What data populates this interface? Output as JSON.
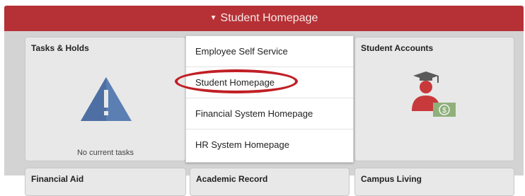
{
  "header": {
    "title": "Student Homepage",
    "caret": "▼"
  },
  "tiles": {
    "tasks": {
      "title": "Tasks & Holds",
      "subtitle": "No current tasks"
    },
    "accounts": {
      "title": "Student Accounts"
    },
    "financial_aid": {
      "title": "Financial Aid"
    },
    "academic_record": {
      "title": "Academic Record"
    },
    "campus_living": {
      "title": "Campus Living"
    }
  },
  "dropdown": {
    "items": [
      {
        "label": "Employee Self Service"
      },
      {
        "label": "Student Homepage"
      },
      {
        "label": "Financial System Homepage"
      },
      {
        "label": "HR System Homepage"
      }
    ]
  },
  "colors": {
    "header": "#b53135",
    "highlight": "#c01f25",
    "warning": "#5b7fb3"
  },
  "icons": {
    "tasks": "warning-triangle-icon",
    "accounts": "graduate-money-icon"
  }
}
